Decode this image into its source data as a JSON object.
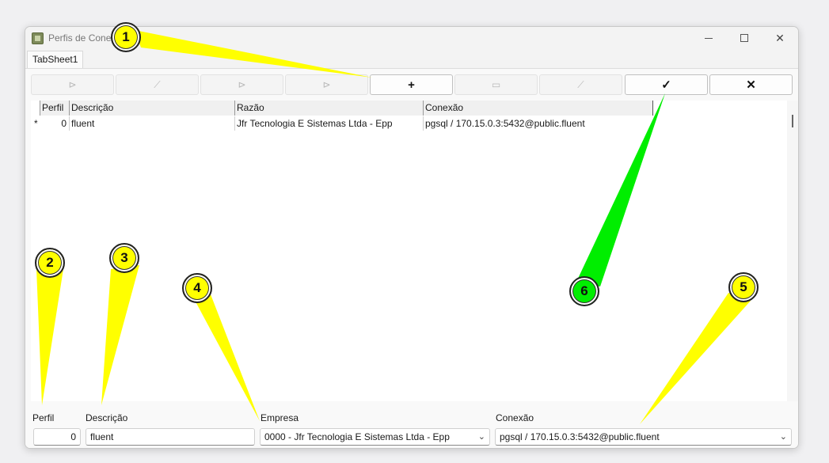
{
  "window": {
    "title": "Perfis de Conexão",
    "controls": {
      "minimize": "minimize",
      "maximize": "maximize",
      "close": "✕"
    }
  },
  "tabs": [
    {
      "label": "TabSheet1"
    }
  ],
  "navigator": {
    "first": "⊳",
    "prior": "⟋",
    "next": "⊳",
    "last": "⊳",
    "insert": "+",
    "delete": "▭",
    "edit": "⟋",
    "post": "✓",
    "cancel": "✕"
  },
  "grid": {
    "columns": [
      "Perfil",
      "Descrição",
      "Razão",
      "Conexão"
    ],
    "rows": [
      {
        "indicator": "*",
        "perfil": "0",
        "descricao": "fluent",
        "razao": "Jfr Tecnologia E Sistemas Ltda - Epp",
        "conexao": "pgsql / 170.15.0.3:5432@public.fluent"
      }
    ]
  },
  "form": {
    "perfil_label": "Perfil",
    "perfil_value": "0",
    "descricao_label": "Descrição",
    "descricao_value": "fluent",
    "empresa_label": "Empresa",
    "empresa_value": "0000 - Jfr Tecnologia E Sistemas Ltda - Epp",
    "conexao_label": "Conexão",
    "conexao_value": "pgsql / 170.15.0.3:5432@public.fluent"
  },
  "callouts": [
    {
      "number": "1",
      "color": "#ffff00"
    },
    {
      "number": "2",
      "color": "#ffff00"
    },
    {
      "number": "3",
      "color": "#ffff00"
    },
    {
      "number": "4",
      "color": "#ffff00"
    },
    {
      "number": "5",
      "color": "#ffff00"
    },
    {
      "number": "6",
      "color": "#00ee00"
    }
  ]
}
